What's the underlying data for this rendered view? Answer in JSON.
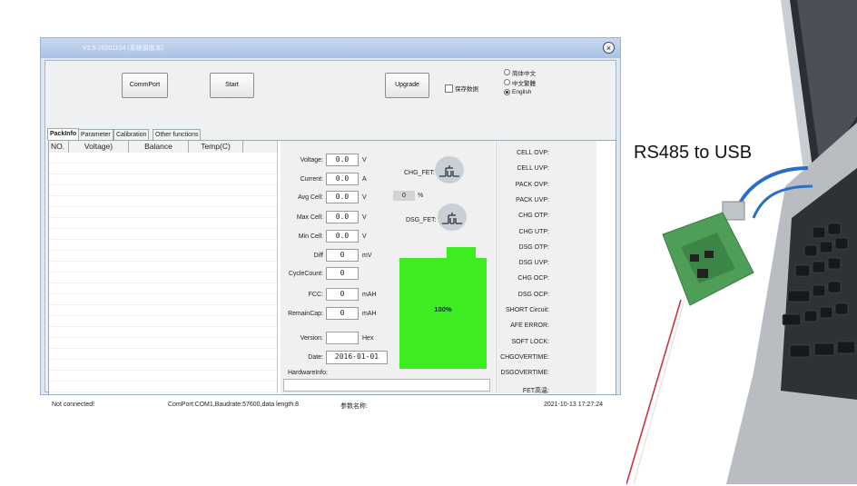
{
  "window": {
    "title": "V2.5-20201104 (系统调度本)",
    "close_icon": "×"
  },
  "toolbar": {
    "commport_label": "CommPort",
    "start_label": "Start",
    "upgrade_label": "Upgrade",
    "save_data_label": "保存数据",
    "languages": [
      "简体中文",
      "中文繁體",
      "English"
    ],
    "selected_language": "English"
  },
  "tabs": [
    "PackInfo",
    "Parameter",
    "Calibration",
    "Other functions"
  ],
  "active_tab": "PackInfo",
  "cell_table": {
    "columns": [
      "NO.",
      "Voltage)",
      "Balance",
      "Temp(C)"
    ]
  },
  "pack": {
    "voltage": {
      "label": "Voltage:",
      "value": "0.0",
      "unit": "V"
    },
    "current": {
      "label": "Current:",
      "value": "0.0",
      "unit": "A"
    },
    "avg_cell": {
      "label": "Avg Cell:",
      "value": "0.0",
      "unit": "V"
    },
    "max_cell": {
      "label": "Max Cell:",
      "value": "0.0",
      "unit": "V"
    },
    "min_cell": {
      "label": "Min Cell:",
      "value": "0.0",
      "unit": "V"
    },
    "diff": {
      "label": "Diff",
      "value": "0",
      "unit": "mV"
    },
    "cycle_count": {
      "label": "CycleCount:",
      "value": "0"
    },
    "fcc": {
      "label": "FCC:",
      "value": "0",
      "unit": "mAH"
    },
    "remain_cap": {
      "label": "RemainCap:",
      "value": "0",
      "unit": "mAH"
    },
    "version": {
      "label": "Version:",
      "value": "",
      "unit": "Hex"
    },
    "date": {
      "label": "Date:",
      "value": "2016-01-01"
    },
    "hardware_info": {
      "label": "HardwareInfo:",
      "value": ""
    },
    "chg_fet_label": "CHG_FET:",
    "dsg_fet_label": "DSG_FET:",
    "soc_value": "0",
    "soc_unit": "%",
    "battery_percent_text": "100%",
    "battery_fill": 1.0
  },
  "protections": [
    "CELL OVP:",
    "CELL UVP:",
    "PACK OVP:",
    "PACK UVP:",
    "CHG OTP:",
    "CHG UTP:",
    "DSG OTP:",
    "DSG UVP:",
    "CHG OCP:",
    "DSG OCP:",
    "SHORT Circuit:",
    "AFE ERROR:",
    "SOFT LOCK:",
    "CHGOVERTIME:",
    "DSGOVERTIME:",
    "FET高温:"
  ],
  "status": {
    "connection": "Not connected!",
    "port_info": "ComPort:COM1,Baudrate:57600,data length:8",
    "param_name": "参数名称:",
    "datetime": "2021-10-13 17:27:24"
  },
  "caption": "RS485 to USB",
  "colors": {
    "battery": "#3dec21",
    "window_frame": "#a9c2e4"
  }
}
